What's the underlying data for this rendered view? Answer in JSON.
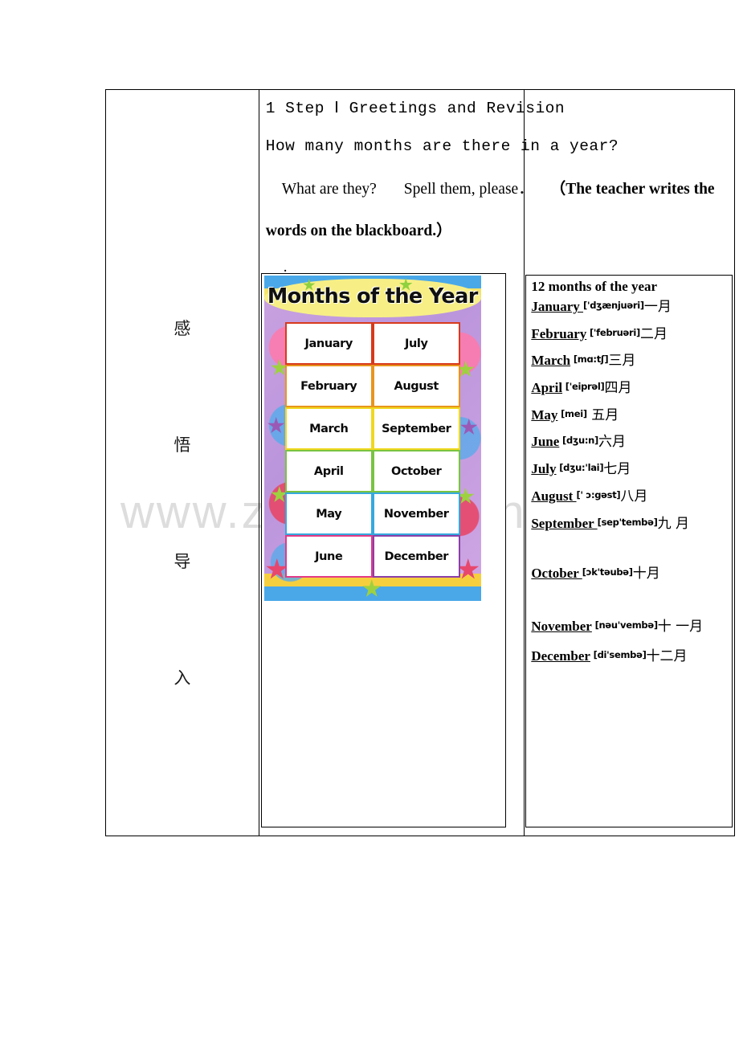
{
  "watermark": "www.zixin.com.cn",
  "stage_label": {
    "characters": [
      "感",
      "悟",
      "导",
      "入"
    ]
  },
  "intro": {
    "line1": "1 Step Ⅰ Greetings and Revision",
    "line2": "How many months are there in a year?",
    "line3_a": "What are they?",
    "line3_b": "Spell them, please．",
    "line3_c": "（The teacher writes the",
    "line4": "words on the blackboard.）",
    "dot": "."
  },
  "poster": {
    "title": "Months of the Year",
    "cells": [
      "January",
      "July",
      "February",
      "August",
      "March",
      "September",
      "April",
      "October",
      "May",
      "November",
      "June",
      "December"
    ]
  },
  "months_box": {
    "heading": "12 months of the year",
    "rows": [
      {
        "name": "January ",
        "ipa": "['dʒænjuəri]",
        "cn": "一月"
      },
      {
        "name": "February",
        "ipa": " ['februəri]",
        "cn": "二月"
      },
      {
        "name": "March",
        "ipa": " [mɑ:tʃ]",
        "cn": "三月"
      },
      {
        "name": "April",
        "ipa": " ['eiprəl]",
        "cn": "四月"
      },
      {
        "name": "May",
        "ipa": " [mei]",
        "cn": " 五月"
      },
      {
        "name": "June",
        "ipa": " [dʒu:n]",
        "cn": "六月"
      },
      {
        "name": "July",
        "ipa": " [dʒu:'lai]",
        "cn": "七月"
      },
      {
        "name": "August ",
        "ipa": "[' ɔ:gəst]",
        "cn": "八月"
      },
      {
        "name": "September ",
        "ipa": " [sep'tembə]",
        "cn": "九 月"
      },
      {
        "name": "October ",
        "ipa": " [ɔk'təubə]",
        "cn": "十月"
      },
      {
        "name": "November",
        "ipa": " [nəu'vembə]",
        "cn": "十 一月"
      },
      {
        "name": "December",
        "ipa": " [di'sembə]",
        "cn": "十二月"
      }
    ]
  }
}
